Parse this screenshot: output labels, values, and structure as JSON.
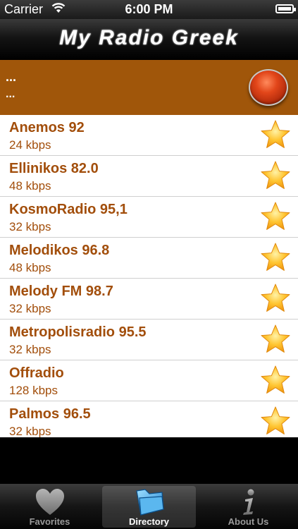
{
  "status_bar": {
    "carrier": "Carrier",
    "time": "6:00 PM"
  },
  "nav": {
    "title": "My Radio Greek"
  },
  "player": {
    "line1": "...",
    "line2": "..."
  },
  "stations": [
    {
      "name": "Anemos 92",
      "bitrate": "24 kbps"
    },
    {
      "name": "Ellinikos 82.0",
      "bitrate": "48 kbps"
    },
    {
      "name": "KosmoRadio 95,1",
      "bitrate": "32 kbps"
    },
    {
      "name": "Melodikos 96.8",
      "bitrate": "48 kbps"
    },
    {
      "name": "Melody FM 98.7",
      "bitrate": "32 kbps"
    },
    {
      "name": "Metropolisradio 95.5",
      "bitrate": "32 kbps"
    },
    {
      "name": "Offradio",
      "bitrate": "128 kbps"
    },
    {
      "name": "Palmos 96.5",
      "bitrate": "32 kbps"
    }
  ],
  "tabs": [
    {
      "label": "Favorites",
      "icon": "heart-icon"
    },
    {
      "label": "Directory",
      "icon": "directory-icon",
      "active": true
    },
    {
      "label": "About Us",
      "icon": "info-icon"
    }
  ],
  "colors": {
    "accent": "#a0560a",
    "text": "#a24e0b",
    "play": "#e2461a"
  }
}
